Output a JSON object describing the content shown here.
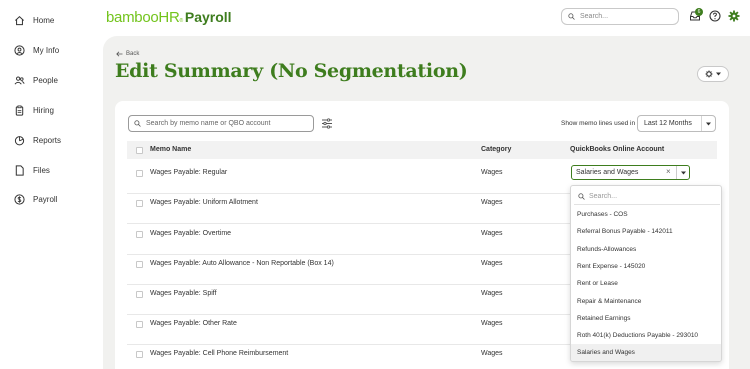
{
  "sidebar": {
    "items": [
      {
        "label": "Home",
        "icon": "home-icon"
      },
      {
        "label": "My Info",
        "icon": "user-circle-icon"
      },
      {
        "label": "People",
        "icon": "people-icon"
      },
      {
        "label": "Hiring",
        "icon": "clipboard-icon"
      },
      {
        "label": "Reports",
        "icon": "pie-chart-icon"
      },
      {
        "label": "Files",
        "icon": "file-icon"
      },
      {
        "label": "Payroll",
        "icon": "dollar-circle-icon"
      }
    ]
  },
  "header": {
    "logo_text": "bambooHR",
    "logo_reg": "®",
    "logo_product": "Payroll",
    "search_placeholder": "Search...",
    "notification_count": "6",
    "brand_color": "#3e7d1e"
  },
  "page": {
    "back_label": "Back",
    "title": "Edit Summary (No Segmentation)"
  },
  "filters": {
    "memo_search_placeholder": "Search by memo name or QBO account",
    "show_label": "Show memo lines used in",
    "months_value": "Last 12 Months"
  },
  "table": {
    "headers": {
      "memo": "Memo Name",
      "category": "Category",
      "qbo": "QuickBooks Online Account"
    },
    "rows": [
      {
        "memo": "Wages Payable: Regular",
        "category": "Wages"
      },
      {
        "memo": "Wages Payable: Uniform Allotment",
        "category": "Wages"
      },
      {
        "memo": "Wages Payable: Overtime",
        "category": "Wages"
      },
      {
        "memo": "Wages Payable: Auto Allowance - Non Reportable (Box 14)",
        "category": "Wages"
      },
      {
        "memo": "Wages Payable: Spiff",
        "category": "Wages"
      },
      {
        "memo": "Wages Payable: Other Rate",
        "category": "Wages"
      },
      {
        "memo": "Wages Payable: Cell Phone Reimbursement",
        "category": "Wages"
      }
    ],
    "qbo_selected": "Salaries and Wages",
    "clear_glyph": "×"
  },
  "dropdown": {
    "search_placeholder": "Search...",
    "options": [
      "Purchases - COS",
      "Referral Bonus Payable - 142011",
      "Refunds-Allowances",
      "Rent Expense - 145020",
      "Rent or Lease",
      "Repair & Maintenance",
      "Retained Earnings",
      "Roth 401(k) Deductions Payable - 293010",
      "Salaries and Wages"
    ]
  }
}
